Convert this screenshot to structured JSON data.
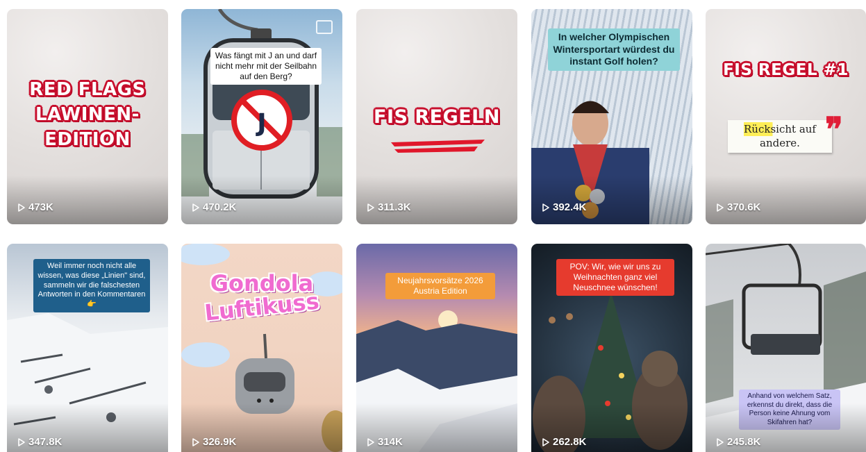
{
  "cards": [
    {
      "views": "473K",
      "headline_lines": [
        "RED FLAGS",
        "LAWINEN-",
        "EDITION"
      ]
    },
    {
      "views": "470.2K",
      "caption": "Was fängt mit J an und darf nicht mehr mit der Seilbahn auf den Berg?",
      "sign_letter": "J"
    },
    {
      "views": "311.3K",
      "headline": "FIS REGELN"
    },
    {
      "views": "392.4K",
      "caption": "In welcher Olympischen Wintersportart würdest du instant Golf holen?"
    },
    {
      "views": "370.6K",
      "headline": "FIS REGEL #1",
      "quote_line1": "Rücksicht auf",
      "quote_line2": "andere."
    },
    {
      "views": "347.8K",
      "caption": "Weil immer noch nicht alle wissen, was diese „Linien\" sind, sammeln wir die falschesten Antworten in den Kommentaren 👉"
    },
    {
      "views": "326.9K",
      "title_line1": "Gondola",
      "title_line2": "Luftikuss"
    },
    {
      "views": "314K",
      "caption_line1": "Neujahrsvorsätze 2026",
      "caption_line2": "Austria Edition"
    },
    {
      "views": "262.8K",
      "caption": "POV: Wir, wie wir uns zu Weihnachten ganz viel Neuschnee wünschen!"
    },
    {
      "views": "245.8K",
      "caption": "Anhand von welchem Satz, erkennst du direkt, dass die Person keine Ahnung vom Skifahren hat?"
    }
  ],
  "colors": {
    "sticker_red": "#c8102e",
    "caption_blue": "#1f5f8b",
    "caption_orange": "#f39c3a",
    "caption_red": "#e63b2e",
    "caption_lavender": "#c9c4f5",
    "caption_teal": "#8fd3d8",
    "title_pink": "#f06bd0"
  }
}
